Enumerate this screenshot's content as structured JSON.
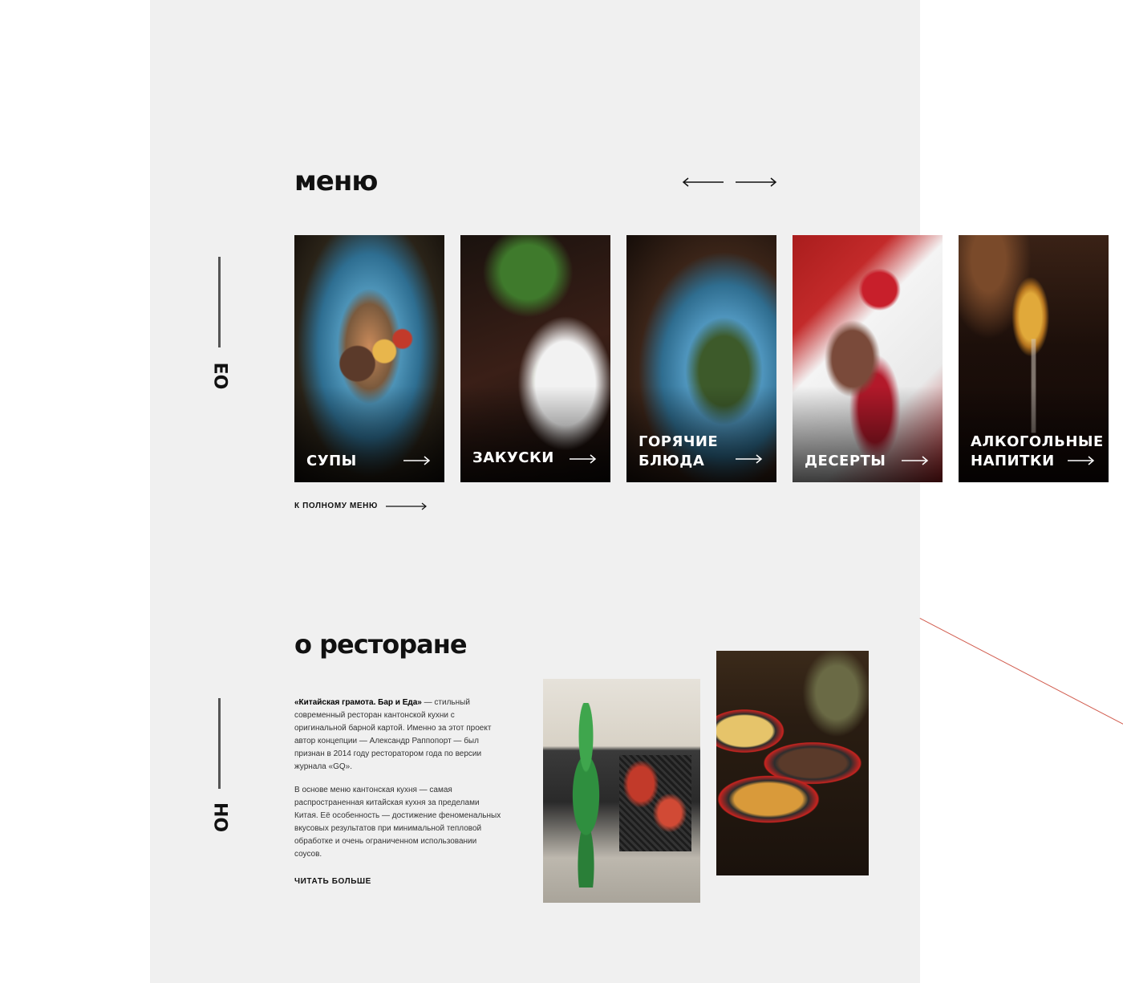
{
  "side_marks": {
    "menu_code": "EO",
    "about_code": "HO"
  },
  "menu": {
    "title": "меню",
    "prev_label": "←",
    "next_label": "→",
    "full_menu_label": "К ПОЛНОМУ МЕНЮ",
    "cards": [
      {
        "label": "супы",
        "icon": "arrow-right-icon"
      },
      {
        "label": "закуски",
        "icon": "arrow-right-icon"
      },
      {
        "label": "горячие блюда",
        "icon": "arrow-right-icon"
      },
      {
        "label": "десерты",
        "icon": "arrow-right-icon"
      },
      {
        "label": "алкогольные напитки",
        "icon": "arrow-right-icon"
      }
    ]
  },
  "about": {
    "title": "о ресторане",
    "para1_bold": "«Китайская грамота. Бар и Еда»",
    "para1_rest": " — стильный современный ресторан кантонской кухни с оригинальной барной картой. Именно за этот проект автор концепции — Александр Раппопорт — был признан в 2014 году ресторатором года по версии журнала «GQ».",
    "para2": "В основе меню кантонская кухня — самая распространенная китайская кухня за пределами Китая. Её особенность — достижение феноменальных вкусовых результатов при минимальной тепловой обработке и очень ограниченном использовании соусов.",
    "read_more": "ЧИТАТЬ БОЛЬШЕ"
  },
  "colors": {
    "panel": "#f0f0f0",
    "accent_line": "#c9402f",
    "text": "#111111"
  }
}
